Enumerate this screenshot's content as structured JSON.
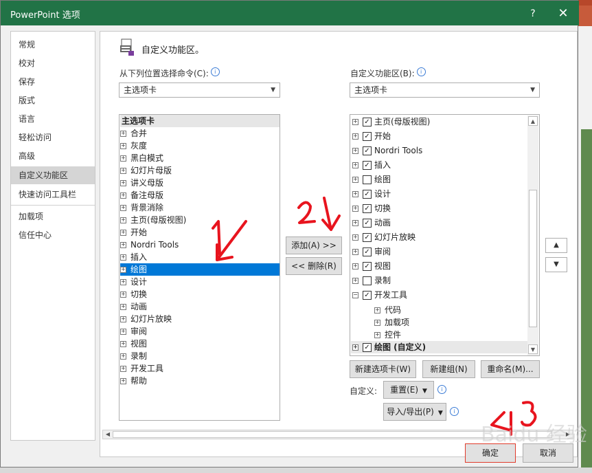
{
  "window": {
    "title": "PowerPoint 选项",
    "help_label": "?",
    "close_label": "✕"
  },
  "sidebar": {
    "items": [
      {
        "label": "常规"
      },
      {
        "label": "校对"
      },
      {
        "label": "保存"
      },
      {
        "label": "版式"
      },
      {
        "label": "语言"
      },
      {
        "label": "轻松访问"
      },
      {
        "label": "高级"
      },
      {
        "label": "自定义功能区"
      },
      {
        "label": "快速访问工具栏"
      },
      {
        "label": "加载项"
      },
      {
        "label": "信任中心"
      }
    ],
    "selected": "自定义功能区"
  },
  "main": {
    "heading": "自定义功能区。",
    "left_label": "从下列位置选择命令(C):",
    "left_combo_value": "主选项卡",
    "right_label": "自定义功能区(B):",
    "right_combo_value": "主选项卡",
    "left_list": {
      "header": "主选项卡",
      "items": [
        "合并",
        "灰度",
        "黑白模式",
        "幻灯片母版",
        "讲义母版",
        "备注母版",
        "背景消除",
        "主页(母版视图)",
        "开始",
        "Nordri Tools",
        "插入",
        "绘图",
        "设计",
        "切换",
        "动画",
        "幻灯片放映",
        "审阅",
        "视图",
        "录制",
        "开发工具",
        "帮助"
      ],
      "selected": "绘图"
    },
    "right_list": {
      "items": [
        {
          "label": "主页(母版视图)",
          "checked": true,
          "level": 0,
          "expander": "+"
        },
        {
          "label": "开始",
          "checked": true,
          "level": 0,
          "expander": "+"
        },
        {
          "label": "Nordri Tools",
          "checked": true,
          "level": 0,
          "expander": "+"
        },
        {
          "label": "插入",
          "checked": true,
          "level": 0,
          "expander": "+"
        },
        {
          "label": "绘图",
          "checked": false,
          "level": 0,
          "expander": "+"
        },
        {
          "label": "设计",
          "checked": true,
          "level": 0,
          "expander": "+"
        },
        {
          "label": "切换",
          "checked": true,
          "level": 0,
          "expander": "+"
        },
        {
          "label": "动画",
          "checked": true,
          "level": 0,
          "expander": "+"
        },
        {
          "label": "幻灯片放映",
          "checked": true,
          "level": 0,
          "expander": "+"
        },
        {
          "label": "审阅",
          "checked": true,
          "level": 0,
          "expander": "+"
        },
        {
          "label": "视图",
          "checked": true,
          "level": 0,
          "expander": "+"
        },
        {
          "label": "录制",
          "checked": false,
          "level": 0,
          "expander": "+"
        },
        {
          "label": "开发工具",
          "checked": true,
          "level": 0,
          "expander": "−"
        },
        {
          "label": "代码",
          "checked": null,
          "level": 1,
          "expander": "+"
        },
        {
          "label": "加载项",
          "checked": null,
          "level": 1,
          "expander": "+"
        },
        {
          "label": "控件",
          "checked": null,
          "level": 1,
          "expander": "+"
        },
        {
          "label": "绘图 (自定义)",
          "checked": true,
          "level": 0,
          "expander": "+"
        }
      ],
      "highlighted": "绘图 (自定义)"
    },
    "add_button": "添加(A) >>",
    "remove_button": "<< 删除(R)",
    "new_tab_button": "新建选项卡(W)",
    "new_group_button": "新建组(N)",
    "rename_button": "重命名(M)...",
    "customize_label": "自定义:",
    "reset_button": "重置(E)",
    "import_export_button": "导入/导出(P)",
    "move_up": "▲",
    "move_down": "▼"
  },
  "footer": {
    "ok": "确定",
    "cancel": "取消"
  },
  "annotations": {
    "one": "1",
    "two": "2",
    "three": "3",
    "color": "#e8141e"
  },
  "watermark": "Baidu 经验"
}
